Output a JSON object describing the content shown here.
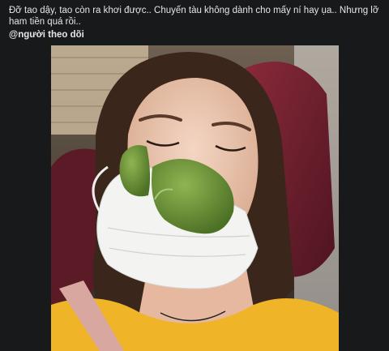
{
  "post": {
    "text": "Đỡ tao dậy, tao còn ra khơi được.. Chuyến tàu không dành cho mấy ní hay ụa.. Nhưng lỡ ham tiền quá rồi..",
    "mention": "@người theo dõi"
  },
  "photo": {
    "subject": "woman sleeping wearing a face mask with a green citrus peel over her nose",
    "background": "train seats"
  },
  "colors": {
    "page_bg": "#18191a",
    "text": "#e4e6eb"
  }
}
